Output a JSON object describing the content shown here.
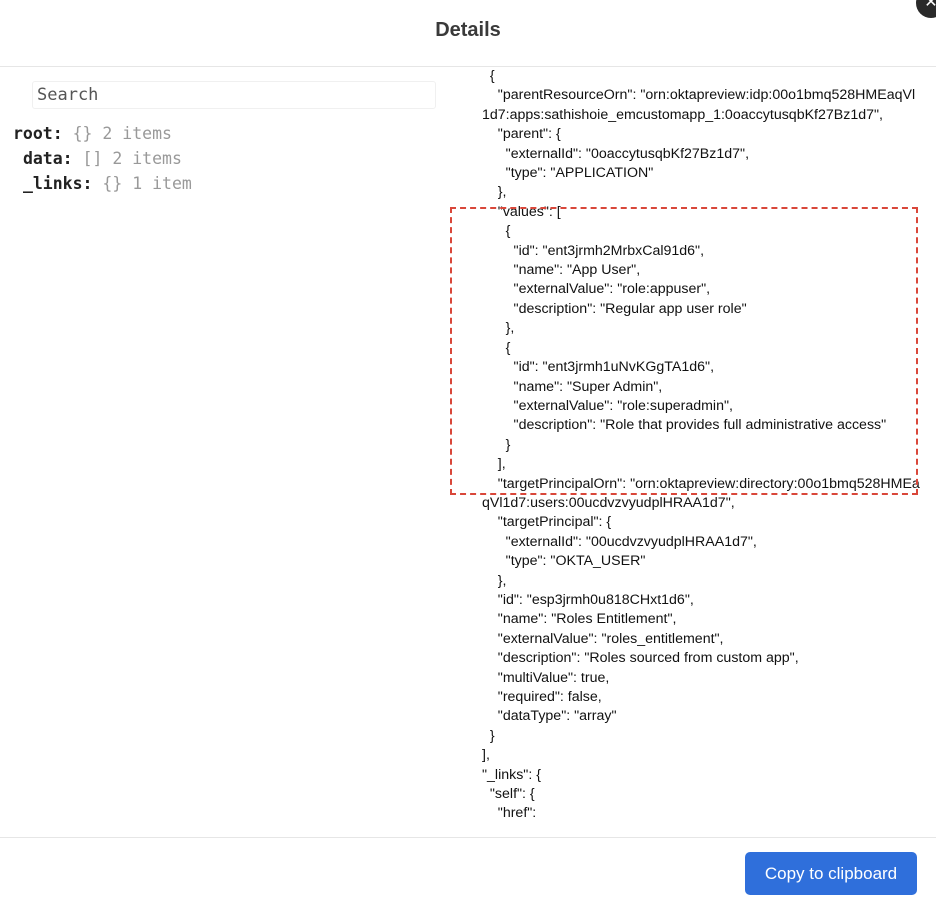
{
  "header": {
    "title": "Details",
    "close_icon": "close-icon"
  },
  "search": {
    "placeholder": "Search"
  },
  "tree": [
    {
      "key": "root:",
      "brace": "{}",
      "count": "2 items"
    },
    {
      "key": "data:",
      "brace": "[]",
      "count": "2 items"
    },
    {
      "key": "_links:",
      "brace": "{}",
      "count": "1 item"
    }
  ],
  "json_text": "  {\n    \"parentResourceOrn\": \"orn:oktapreview:idp:00o1bmq528HMEaqVl1d7:apps:sathishoie_emcustomapp_1:0oaccytusqbKf27Bz1d7\",\n    \"parent\": {\n      \"externalId\": \"0oaccytusqbKf27Bz1d7\",\n      \"type\": \"APPLICATION\"\n    },\n    \"values\": [\n      {\n        \"id\": \"ent3jrmh2MrbxCal91d6\",\n        \"name\": \"App User\",\n        \"externalValue\": \"role:appuser\",\n        \"description\": \"Regular app user role\"\n      },\n      {\n        \"id\": \"ent3jrmh1uNvKGgTA1d6\",\n        \"name\": \"Super Admin\",\n        \"externalValue\": \"role:superadmin\",\n        \"description\": \"Role that provides full administrative access\"\n      }\n    ],\n    \"targetPrincipalOrn\": \"orn:oktapreview:directory:00o1bmq528HMEaqVl1d7:users:00ucdvzvyudplHRAA1d7\",\n    \"targetPrincipal\": {\n      \"externalId\": \"00ucdvzvyudplHRAA1d7\",\n      \"type\": \"OKTA_USER\"\n    },\n    \"id\": \"esp3jrmh0u818CHxt1d6\",\n    \"name\": \"Roles Entitlement\",\n    \"externalValue\": \"roles_entitlement\",\n    \"description\": \"Roles sourced from custom app\",\n    \"multiValue\": true,\n    \"required\": false,\n    \"dataType\": \"array\"\n  }\n],\n\"_links\": {\n  \"self\": {\n    \"href\":",
  "footer": {
    "copy_label": "Copy to clipboard"
  },
  "colors": {
    "accent": "#2f6fdb",
    "highlight": "#d9473a"
  }
}
